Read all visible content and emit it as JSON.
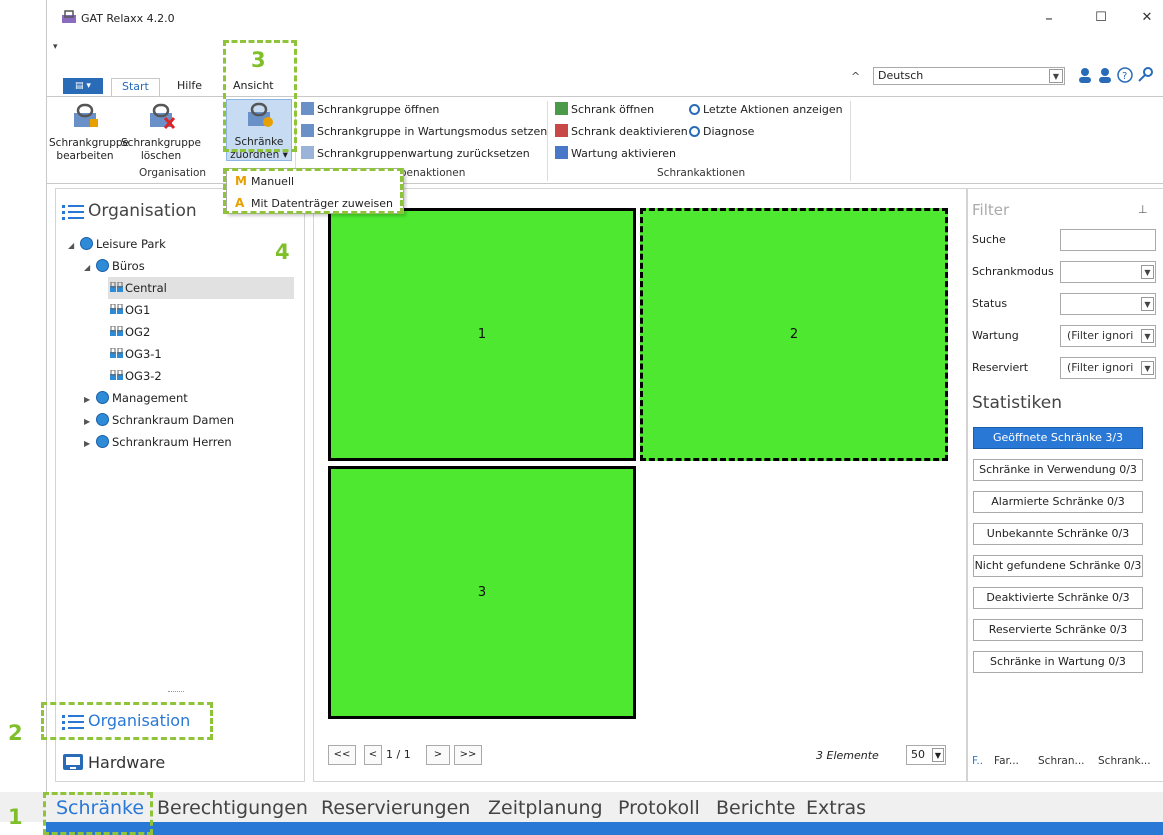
{
  "window": {
    "title": "GAT Relaxx 4.2.0",
    "minimize": "–",
    "maximize": "☐",
    "close": "✕",
    "qat": "▾"
  },
  "ribbon": {
    "file_tab": "▤ ▾",
    "tabs": [
      "Start",
      "Hilfe",
      "Ansicht"
    ],
    "language": "Deutsch",
    "collapse": "^",
    "organisation_group": {
      "label": "Organisation",
      "edit": [
        "Schrankgruppe",
        "bearbeiten"
      ],
      "delete": [
        "Schrankgruppe",
        "löschen"
      ],
      "assign": [
        "Schränke",
        "zuordnen ▾"
      ]
    },
    "group_actions": {
      "label": "Schrankgruppenaktionen",
      "items": [
        "Schrankgruppe öffnen",
        "Schrankgruppe in Wartungsmodus setzen",
        "Schrankgruppenwartung zurücksetzen"
      ]
    },
    "locker_actions": {
      "label": "Schrankaktionen",
      "items": [
        "Schrank öffnen",
        "Schrank deaktivieren",
        "Wartung aktivieren",
        "Letzte Aktionen anzeigen",
        "Diagnose"
      ]
    }
  },
  "dropdown": {
    "items": [
      {
        "key": "M",
        "label": "Manuell"
      },
      {
        "key": "A",
        "label": "Mit Datenträger zuweisen"
      }
    ]
  },
  "left_panel": {
    "title": "Organisation",
    "tree": [
      {
        "label": "Leisure Park",
        "level": 0,
        "type": "group",
        "expanded": true
      },
      {
        "label": "Büros",
        "level": 1,
        "type": "group",
        "expanded": true
      },
      {
        "label": "Central",
        "level": 2,
        "type": "locker",
        "selected": true
      },
      {
        "label": "OG1",
        "level": 2,
        "type": "locker"
      },
      {
        "label": "OG2",
        "level": 2,
        "type": "locker"
      },
      {
        "label": "OG3-1",
        "level": 2,
        "type": "locker"
      },
      {
        "label": "OG3-2",
        "level": 2,
        "type": "locker"
      },
      {
        "label": "Management",
        "level": 1,
        "type": "group",
        "expanded": false
      },
      {
        "label": "Schrankraum Damen",
        "level": 1,
        "type": "group",
        "expanded": false
      },
      {
        "label": "Schrankraum Herren",
        "level": 1,
        "type": "group",
        "expanded": false
      }
    ],
    "bottom_items": [
      "Organisation",
      "Hardware"
    ]
  },
  "grid": {
    "lockers": [
      "1",
      "2",
      "3"
    ],
    "pager": {
      "first": "<<",
      "prev": "<",
      "page": "1 / 1",
      "next": ">",
      "last": ">>"
    },
    "count": "3 Elemente",
    "page_size": "50"
  },
  "filter": {
    "title": "Filter",
    "pin": "⊥",
    "fields": [
      {
        "label": "Suche",
        "value": "",
        "dropdown": false
      },
      {
        "label": "Schrankmodus",
        "value": "",
        "dropdown": true
      },
      {
        "label": "Status",
        "value": "",
        "dropdown": true
      },
      {
        "label": "Wartung",
        "value": "(Filter ignori",
        "dropdown": true
      },
      {
        "label": "Reserviert",
        "value": "(Filter ignori",
        "dropdown": true
      }
    ],
    "stats_title": "Statistiken",
    "stats": [
      "Geöffnete Schränke 3/3",
      "Schränke in Verwendung 0/3",
      "Alarmierte Schränke 0/3",
      "Unbekannte Schränke 0/3",
      "Nicht gefundene Schränke 0/3",
      "Deaktivierte Schränke 0/3",
      "Reservierte Schränke 0/3",
      "Schränke in Wartung 0/3"
    ],
    "tabs": [
      "F..",
      "Far...",
      "Schran...",
      "Schrank..."
    ]
  },
  "navbar": [
    "Schränke",
    "Berechtigungen",
    "Reservierungen",
    "Zeitplanung",
    "Protokoll",
    "Berichte",
    "Extras"
  ],
  "callouts": [
    "1",
    "2",
    "3",
    "4"
  ],
  "colors": {
    "locker_green": "#4de82f",
    "accent": "#2a78d6",
    "callout": "#8fc43a"
  }
}
